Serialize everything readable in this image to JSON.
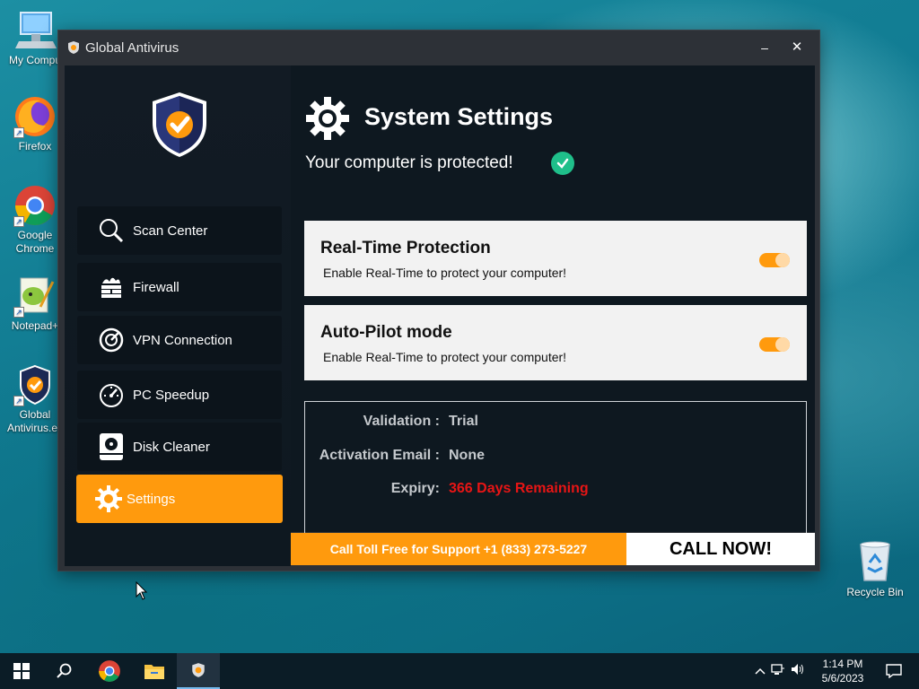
{
  "desktop": {
    "icons": [
      {
        "label": "My Compu"
      },
      {
        "label": "Firefox"
      },
      {
        "label": "Google\nChrome"
      },
      {
        "label": "Notepad+"
      },
      {
        "label": "Global\nAntivirus.ex"
      }
    ],
    "recycle_bin": "Recycle Bin"
  },
  "window": {
    "title": "Global Antivirus",
    "minimize": "–",
    "close": "✕"
  },
  "sidebar": {
    "items": [
      {
        "label": "Scan Center",
        "icon": "search-icon"
      },
      {
        "label": "Firewall",
        "icon": "firewall-icon"
      },
      {
        "label": "VPN Connection",
        "icon": "vpn-icon"
      },
      {
        "label": "PC Speedup",
        "icon": "speedometer-icon"
      },
      {
        "label": "Disk Cleaner",
        "icon": "disk-icon"
      },
      {
        "label": "Settings",
        "icon": "gear-icon",
        "active": true
      }
    ]
  },
  "main": {
    "title": "System Settings",
    "status": "Your computer is protected!",
    "cards": [
      {
        "title": "Real-Time Protection",
        "desc": "Enable Real-Time to protect your computer!",
        "enabled": true
      },
      {
        "title": "Auto-Pilot mode",
        "desc": "Enable Real-Time to protect your computer!",
        "enabled": true
      }
    ],
    "info": {
      "validation_label": "Validation :",
      "validation_value": "Trial",
      "email_label": "Activation Email :",
      "email_value": "None",
      "expiry_label": "Expiry:",
      "expiry_value": "366 Days Remaining"
    }
  },
  "footer": {
    "support": "Call Toll Free for Support +1 (833) 273-5227",
    "call_now": "CALL NOW!"
  },
  "taskbar": {
    "time": "1:14 PM",
    "date": "5/6/2023"
  },
  "colors": {
    "accent": "#ff9a0d",
    "panel": "#0e1820",
    "expiry": "#e81515",
    "ok": "#1fbf8a"
  }
}
